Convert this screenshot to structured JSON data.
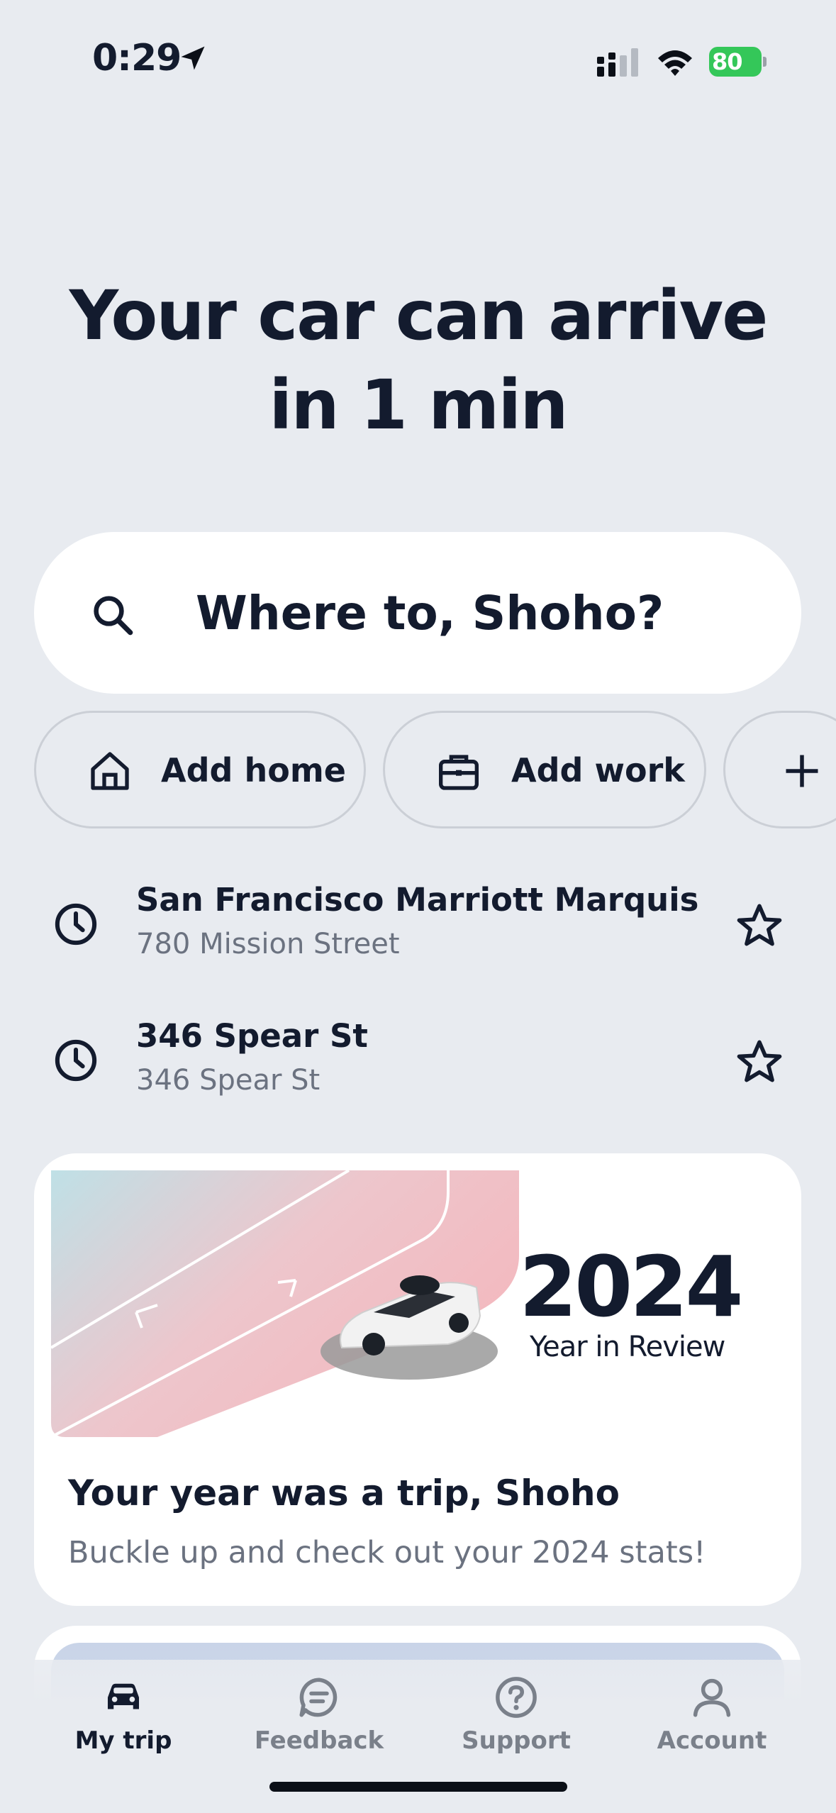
{
  "status_bar": {
    "time": "0:29",
    "battery": "80",
    "icons": [
      "location-arrow-icon",
      "signal-icon",
      "wifi-icon",
      "battery-icon"
    ]
  },
  "headline": {
    "line1": "Your car can arrive",
    "line2": "in 1 min"
  },
  "search": {
    "label": "Where to, Shoho?",
    "icon": "search-icon"
  },
  "chips": [
    {
      "label": "Add home",
      "icon": "home-icon"
    },
    {
      "label": "Add work",
      "icon": "briefcase-icon"
    },
    {
      "label": "",
      "icon": "plus-icon"
    }
  ],
  "recent": [
    {
      "title": "San Francisco Marriott Marquis",
      "subtitle": "780 Mission Street",
      "icon": "clock-icon",
      "action_icon": "star-icon"
    },
    {
      "title": "346 Spear St",
      "subtitle": "346 Spear St",
      "icon": "clock-icon",
      "action_icon": "star-icon"
    }
  ],
  "promo": {
    "art_year": "2024",
    "art_caption": "Year in Review",
    "title": "Your year was a trip, Shoho",
    "subtitle": "Buckle up and check out your 2024 stats!"
  },
  "tabs": [
    {
      "label": "My trip",
      "icon": "car-icon",
      "active": true
    },
    {
      "label": "Feedback",
      "icon": "chat-icon",
      "active": false
    },
    {
      "label": "Support",
      "icon": "help-icon",
      "active": false
    },
    {
      "label": "Account",
      "icon": "person-icon",
      "active": false
    }
  ],
  "colors": {
    "background": "#E8EBF0",
    "text": "#131B2E",
    "muted": "#6B7280",
    "battery": "#34C759"
  }
}
